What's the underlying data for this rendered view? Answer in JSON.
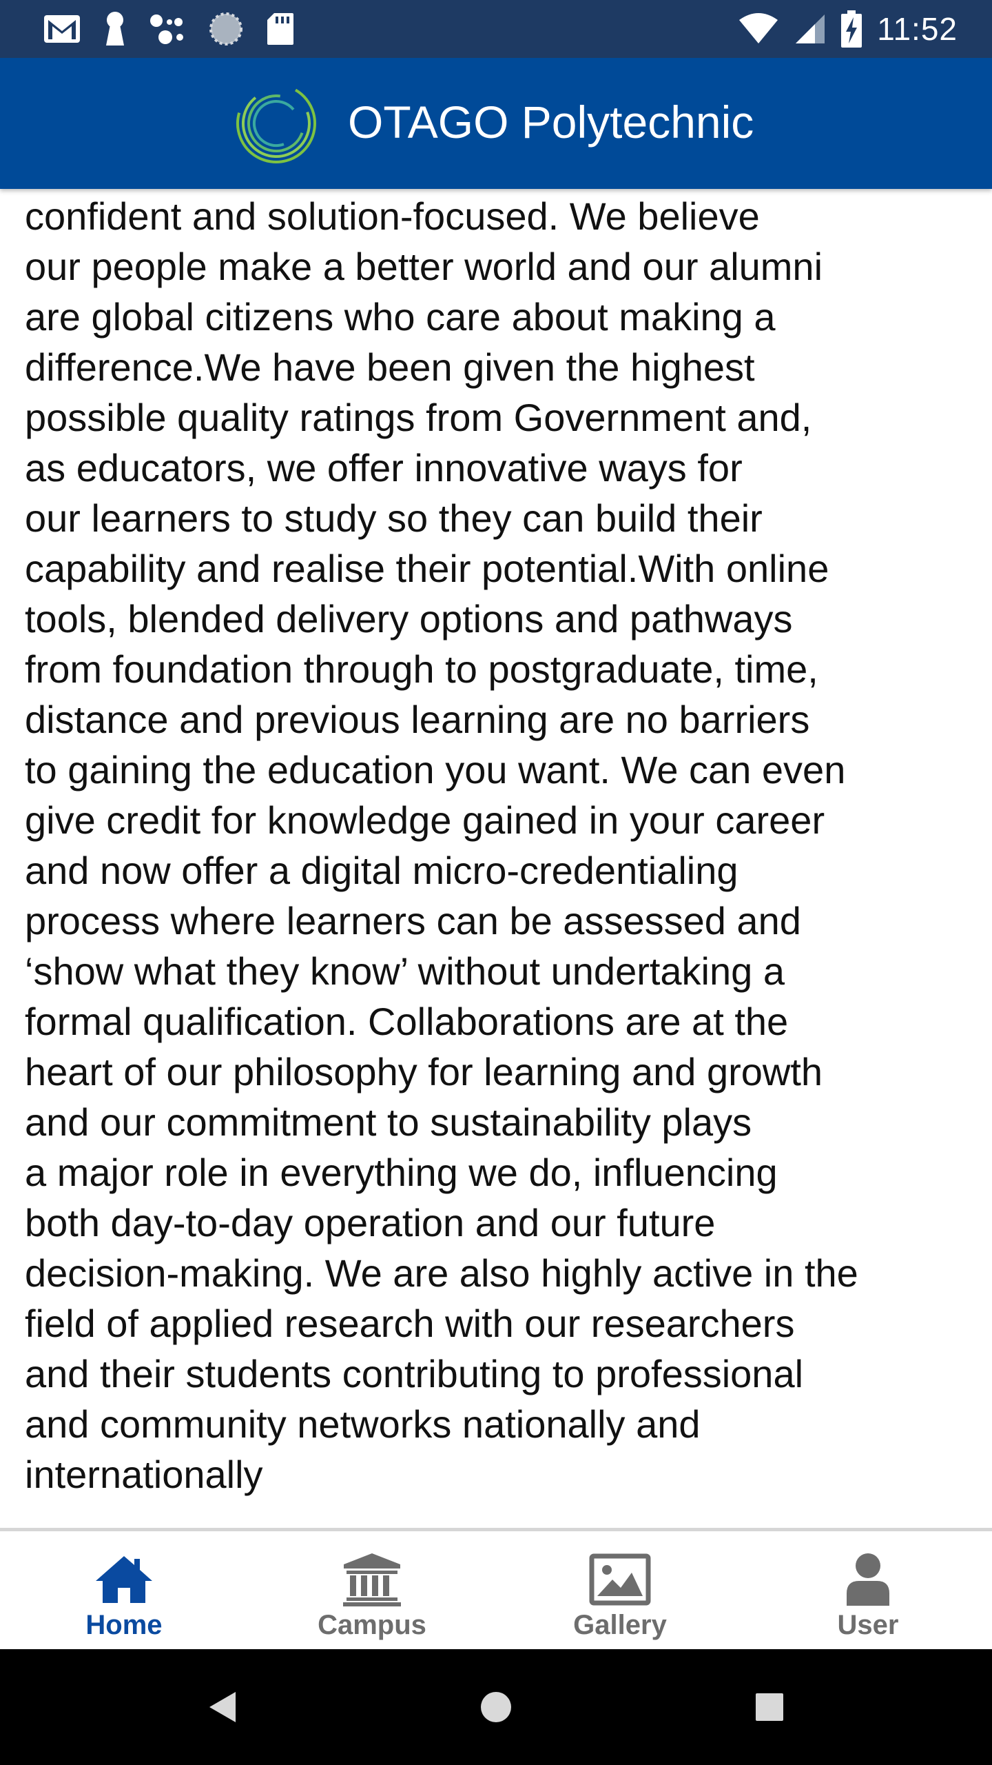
{
  "status_bar": {
    "time": "11:52",
    "left_icons": [
      "gmail-icon",
      "keyhole-icon",
      "connection-icon",
      "loading-icon",
      "sd-card-icon"
    ],
    "right_icons": [
      "wifi-icon",
      "cell-signal-icon",
      "battery-charging-icon"
    ],
    "background": "#1e3a63"
  },
  "app_bar": {
    "title": "OTAGO Polytechnic",
    "background": "#004a98",
    "logo_colors": [
      "#7dc242",
      "#3aa9a0"
    ]
  },
  "content": {
    "text": "love our graduates because they are work-ready,\nconfident and solution-focused. We believe\nour people make a better world and our alumni\nare global citizens who care about making a\ndifference.We have been given the highest\npossible quality ratings from Government and,\nas educators, we offer innovative ways for\nour learners to study so they can build their\ncapability and realise their potential.With online\ntools, blended delivery options and pathways\nfrom foundation through to postgraduate, time,\ndistance and previous learning are no barriers\nto gaining the education you want. We can even\ngive credit for knowledge gained in your career\nand now offer a digital micro-credentialing\nprocess where learners can be assessed and\n‘show what they know’ without undertaking a\nformal qualification. Collaborations are at the\nheart of our philosophy for learning and growth\nand our commitment to sustainability plays\na major role in everything we do, influencing\nboth day-to-day operation and our future\ndecision-making. We are also highly active in the\nfield of applied research with our researchers\nand their students contributing to professional\nand community networks nationally and\ninternationally"
  },
  "bottom_nav": {
    "items": [
      {
        "label": "Home",
        "icon": "home-icon",
        "active": true
      },
      {
        "label": "Campus",
        "icon": "campus-icon",
        "active": false
      },
      {
        "label": "Gallery",
        "icon": "gallery-icon",
        "active": false
      },
      {
        "label": "User",
        "icon": "user-icon",
        "active": false
      }
    ],
    "active_color": "#0a4aa0",
    "inactive_color": "#6d6d6d"
  },
  "system_nav": {
    "buttons": [
      "back-icon",
      "home-circle-icon",
      "recents-icon"
    ]
  }
}
